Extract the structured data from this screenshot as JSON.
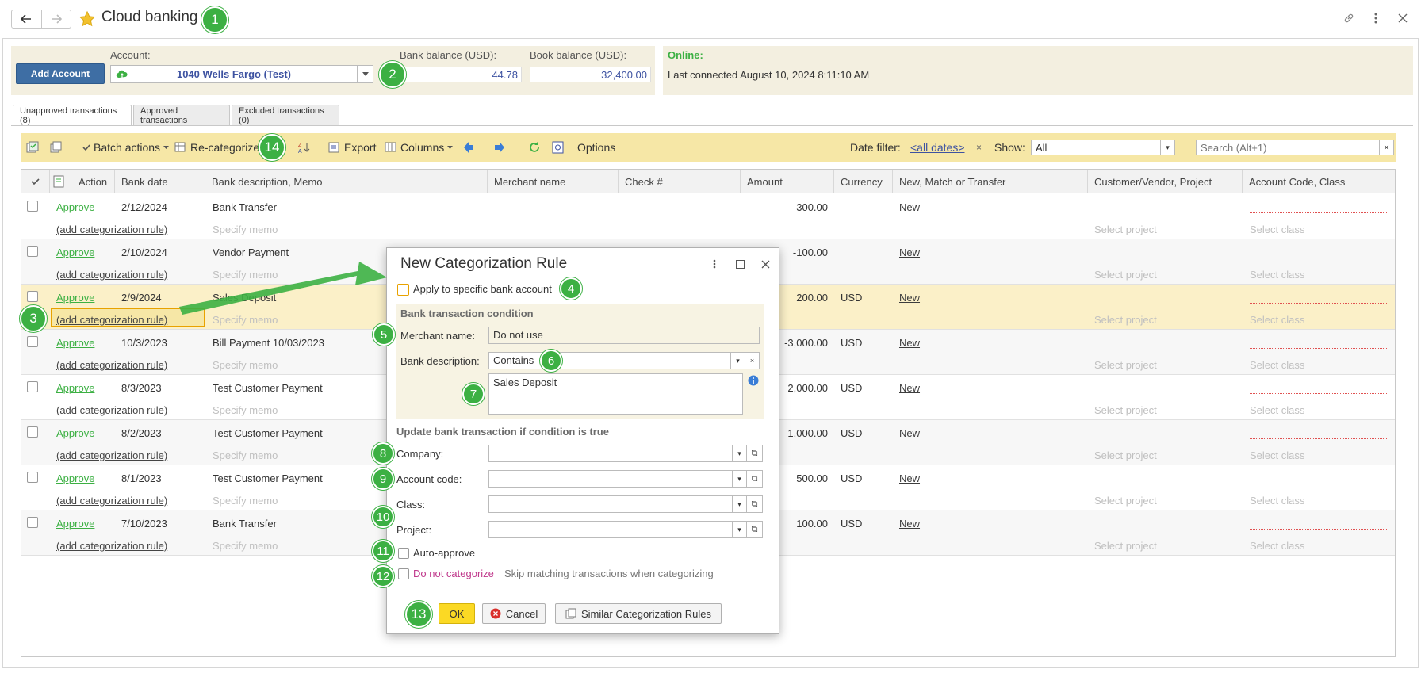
{
  "header": {
    "title": "Cloud banking",
    "back_icon": "back-arrow-icon",
    "forward_icon": "forward-arrow-icon",
    "favorite_icon": "star-icon",
    "right_icons": [
      "link-icon",
      "more-vertical-icon",
      "close-icon"
    ]
  },
  "account_panel": {
    "add_account_label": "Add Account",
    "account_label": "Account:",
    "account_value": "1040 Wells Fargo (Test)",
    "bank_balance_label": "Bank balance (USD):",
    "bank_balance_value": "44.78",
    "book_balance_label": "Book balance (USD):",
    "book_balance_value": "32,400.00"
  },
  "online_panel": {
    "status": "Online:",
    "last_connected": "Last connected August 10, 2024 8:11:10 AM"
  },
  "tabs": [
    {
      "label": "Unapproved transactions (8)",
      "active": true
    },
    {
      "label": "Approved transactions",
      "active": false
    },
    {
      "label": "Excluded transactions (0)",
      "active": false
    }
  ],
  "toolbar": {
    "batch_actions": "Batch actions",
    "recategorize": "Re-categorize",
    "export": "Export",
    "columns": "Columns",
    "options": "Options",
    "date_filter_label": "Date filter:",
    "date_filter_value": "<all dates>",
    "date_filter_clear": "×",
    "show_label": "Show:",
    "show_value": "All",
    "search_placeholder": "Search (Alt+1)"
  },
  "grid": {
    "columns": [
      "Action",
      "Bank date",
      "Bank description, Memo",
      "Merchant name",
      "Check #",
      "Amount",
      "Currency",
      "New, Match or Transfer",
      "Customer/Vendor, Project",
      "Account Code, Class"
    ],
    "approve_label": "Approve",
    "rule_label": "(add categorization rule)",
    "memo_placeholder": "Specify memo",
    "project_placeholder": "Select project",
    "class_placeholder": "Select class",
    "rows": [
      {
        "date": "2/12/2024",
        "desc": "Bank Transfer",
        "amount": "300.00",
        "currency": "",
        "match": "New"
      },
      {
        "date": "2/10/2024",
        "desc": "Vendor Payment",
        "amount": "-100.00",
        "currency": "",
        "match": "New"
      },
      {
        "date": "2/9/2024",
        "desc": "Sales Deposit",
        "amount": "200.00",
        "currency": "USD",
        "match": "New"
      },
      {
        "date": "10/3/2023",
        "desc": "Bill Payment 10/03/2023",
        "amount": "-3,000.00",
        "currency": "USD",
        "match": "New"
      },
      {
        "date": "8/3/2023",
        "desc": "Test Customer Payment",
        "amount": "2,000.00",
        "currency": "USD",
        "match": "New"
      },
      {
        "date": "8/2/2023",
        "desc": "Test Customer Payment",
        "amount": "1,000.00",
        "currency": "USD",
        "match": "New"
      },
      {
        "date": "8/1/2023",
        "desc": "Test Customer Payment",
        "amount": "500.00",
        "currency": "USD",
        "match": "New"
      },
      {
        "date": "7/10/2023",
        "desc": "Bank Transfer",
        "amount": "100.00",
        "currency": "USD",
        "match": "New"
      }
    ]
  },
  "dialog": {
    "title": "New Categorization Rule",
    "apply_specific_account": "Apply to specific bank account",
    "condition_heading": "Bank transaction condition",
    "merchant_label": "Merchant name:",
    "merchant_value": "Do not use",
    "bank_desc_label": "Bank description:",
    "bank_desc_operator": "Contains",
    "bank_desc_text": "Sales Deposit",
    "update_heading": "Update bank transaction if condition is true",
    "company_label": "Company:",
    "account_code_label": "Account code:",
    "class_label": "Class:",
    "project_label": "Project:",
    "auto_approve_label": "Auto-approve",
    "do_not_categorize_label": "Do not categorize",
    "do_not_categorize_hint": "Skip matching transactions when categorizing",
    "ok_label": "OK",
    "cancel_label": "Cancel",
    "similar_rules_label": "Similar Categorization Rules"
  },
  "badges": [
    "1",
    "2",
    "3",
    "4",
    "5",
    "6",
    "7",
    "8",
    "9",
    "10",
    "11",
    "12",
    "13",
    "14"
  ],
  "colors": {
    "accent_green": "#3cb043",
    "toolbar_yellow": "#f6e7a6",
    "panel_beige": "#f3efe0",
    "link_blue": "#3d52a1",
    "ok_yellow": "#fbd924"
  }
}
